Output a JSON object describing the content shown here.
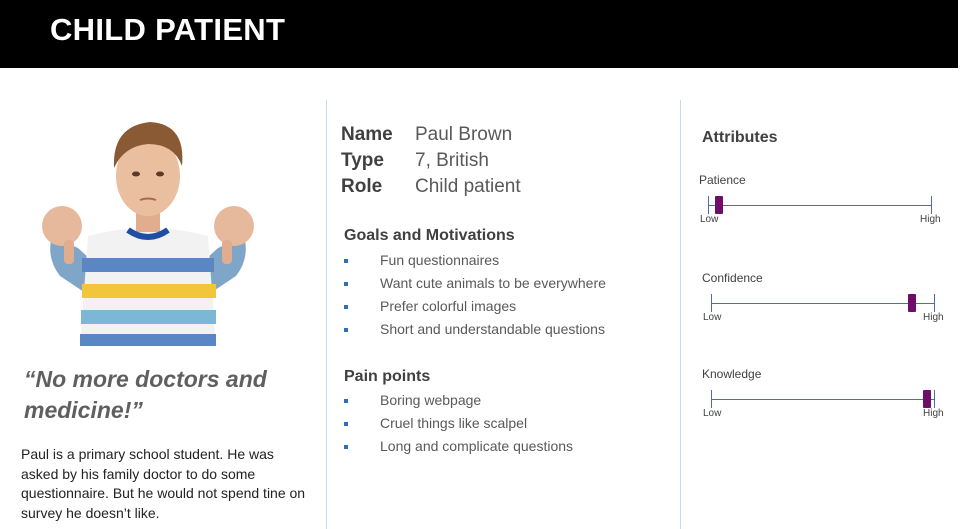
{
  "title": "CHILD PATIENT",
  "quote": "“No more doctors and medicine!”",
  "bio": "Paul is a primary school student. He was asked by his family doctor to do some questionnaire. But he would not spend tine on survey he doesn’t like.",
  "profile": [
    {
      "label": "Name",
      "value": "Paul Brown"
    },
    {
      "label": "Type",
      "value": "7, British"
    },
    {
      "label": "Role",
      "value": "Child patient"
    }
  ],
  "goals": {
    "title": "Goals and Motivations",
    "items": [
      "Fun questionnaires",
      "Want cute animals to be everywhere",
      "Prefer colorful images",
      "Short and understandable questions"
    ]
  },
  "pain_points": {
    "title": "Pain points",
    "items": [
      "Boring webpage",
      "Cruel things like scalpel",
      "Long and complicate questions"
    ]
  },
  "attributes": {
    "title": "Attributes",
    "low_label": "Low",
    "high_label": "High",
    "accent_color": "#6d0f6a",
    "items": [
      {
        "name": "Patience",
        "level": 0.05
      },
      {
        "name": "Confidence",
        "level": 0.9
      },
      {
        "name": "Knowledge",
        "level": 0.97
      }
    ]
  }
}
